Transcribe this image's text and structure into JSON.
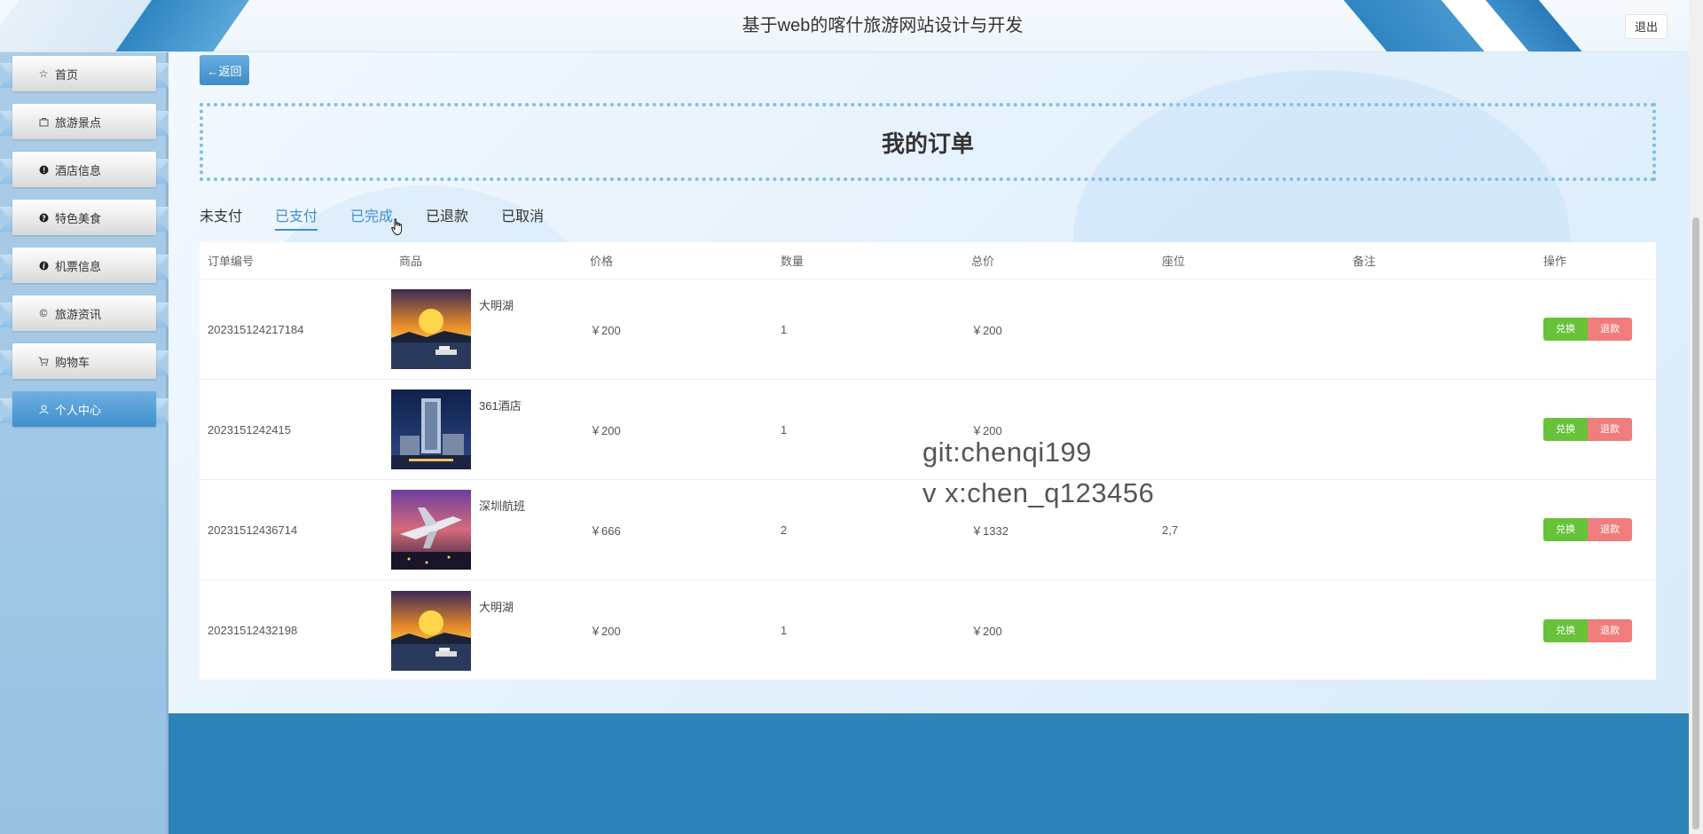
{
  "header": {
    "title": "基于web的喀什旅游网站设计与开发",
    "logout_label": "退出"
  },
  "sidebar": {
    "items": [
      {
        "label": "首页",
        "icon": "star-icon"
      },
      {
        "label": "旅游景点",
        "icon": "bag-icon"
      },
      {
        "label": "酒店信息",
        "icon": "info-icon"
      },
      {
        "label": "特色美食",
        "icon": "question-icon"
      },
      {
        "label": "机票信息",
        "icon": "info-italic-icon"
      },
      {
        "label": "旅游资讯",
        "icon": "copyright-icon"
      },
      {
        "label": "购物车",
        "icon": "cart-icon"
      },
      {
        "label": "个人中心",
        "icon": "user-icon"
      }
    ],
    "active_index": 7
  },
  "main": {
    "back_label": "←返回",
    "page_title": "我的订单",
    "tabs": [
      "未支付",
      "已支付",
      "已完成",
      "已退款",
      "已取消"
    ],
    "active_tab": 1
  },
  "table": {
    "headers": [
      "订单编号",
      "商品",
      "价格",
      "数量",
      "总价",
      "座位",
      "备注",
      "操作"
    ],
    "rows": [
      {
        "order_no": "202315124217184",
        "product": "大明湖",
        "price": "￥200",
        "qty": "1",
        "total": "￥200",
        "seat": "",
        "note": "",
        "thumb": "lake"
      },
      {
        "order_no": "2023151242415",
        "product": "361酒店",
        "price": "￥200",
        "qty": "1",
        "total": "￥200",
        "seat": "",
        "note": "",
        "thumb": "hotel"
      },
      {
        "order_no": "20231512436714",
        "product": "深圳航班",
        "price": "￥666",
        "qty": "2",
        "total": "￥1332",
        "seat": "2,7",
        "note": "",
        "thumb": "plane"
      },
      {
        "order_no": "20231512432198",
        "product": "大明湖",
        "price": "￥200",
        "qty": "1",
        "total": "￥200",
        "seat": "",
        "note": "",
        "thumb": "lake"
      }
    ],
    "action_exchange": "兑换",
    "action_refund": "退款"
  },
  "watermark": {
    "line1": "git:chenqi199",
    "line2": "v x:chen_q123456"
  },
  "colors": {
    "accent": "#3a8fd6",
    "exchange": "#67c23a",
    "refund": "#f07c7c",
    "footer": "#2e83b8"
  }
}
